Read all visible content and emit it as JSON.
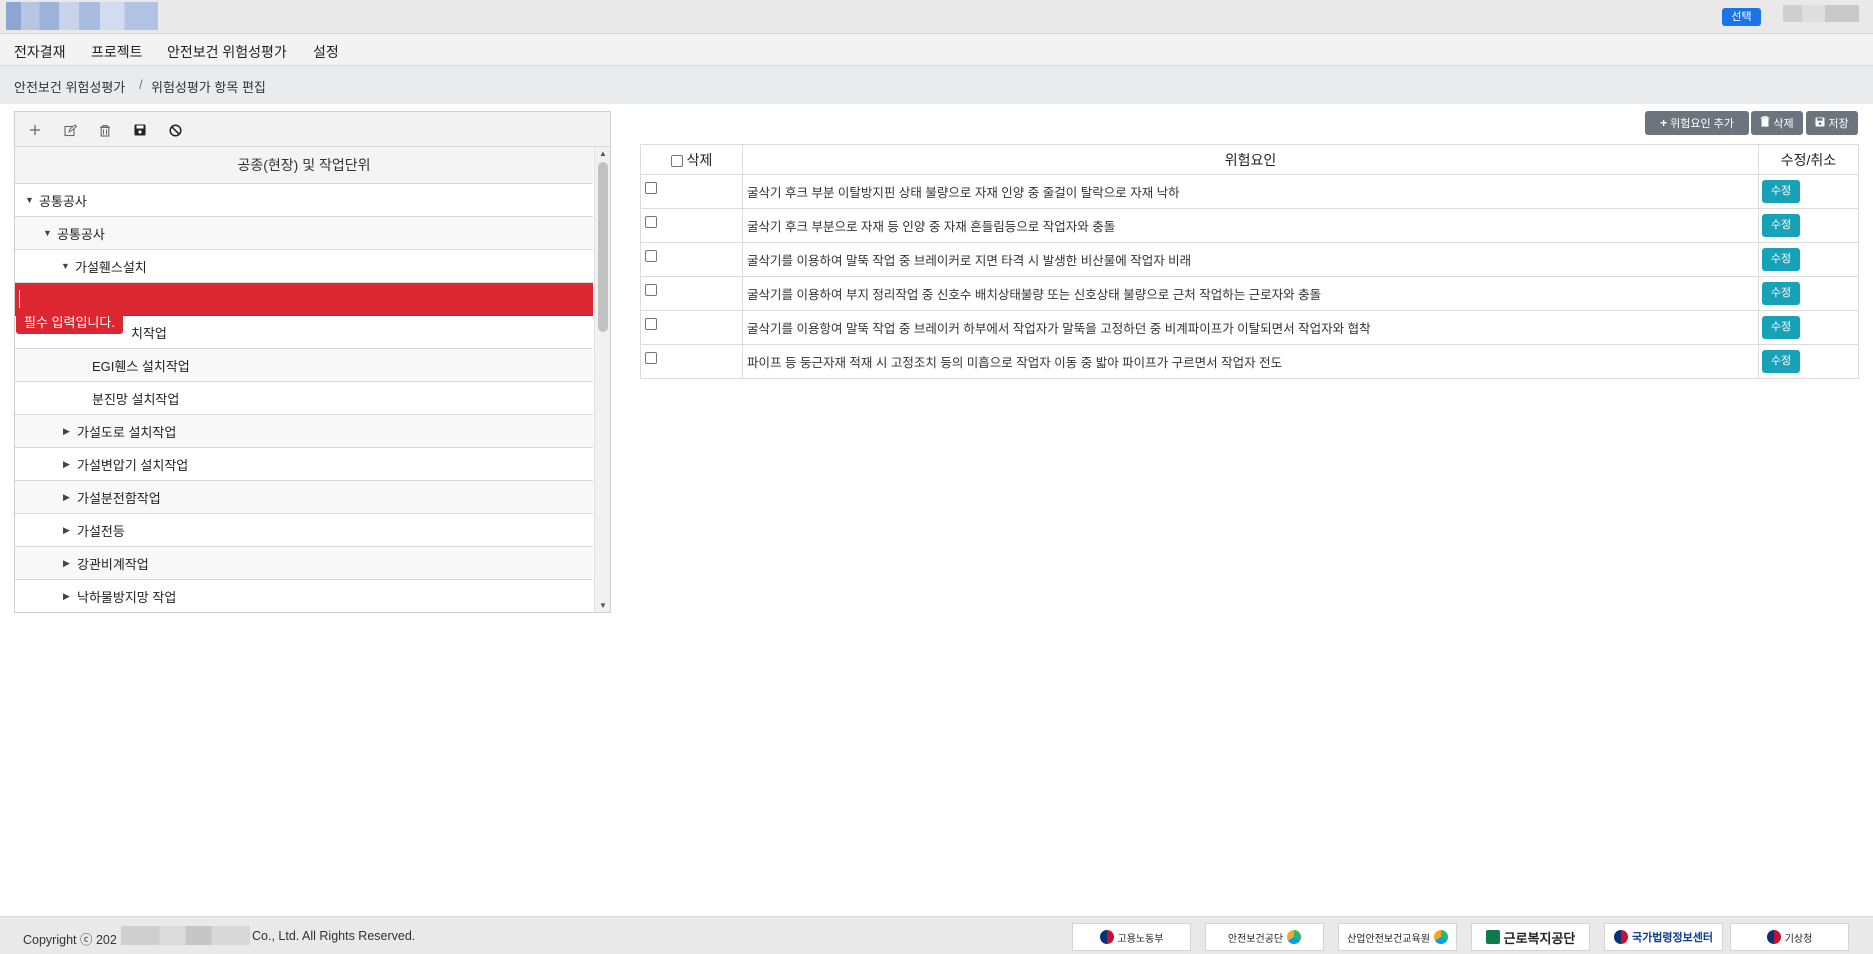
{
  "topbar": {
    "select_label": "선택"
  },
  "menu": [
    "전자결재",
    "프로젝트",
    "안전보건 위험성평가",
    "설정"
  ],
  "breadcrumb": {
    "parent": "안전보건 위험성평가",
    "separator": "/",
    "current": "위험성평가 항목 편집"
  },
  "tree": {
    "header": "공종(현장) 및 작업단위",
    "error_message": "필수 입력입니다.",
    "edit_value": "",
    "rows": [
      {
        "label": "공통공사",
        "level": 0,
        "state": "expanded"
      },
      {
        "label": "공통공사",
        "level": 1,
        "state": "expanded"
      },
      {
        "label": "가설휀스설치",
        "level": 2,
        "state": "expanded"
      },
      {
        "label": "",
        "level": 3,
        "state": "editing"
      },
      {
        "label": "치작업",
        "level": 3,
        "state": "leaf"
      },
      {
        "label": "EGI휀스 설치작업",
        "level": 3,
        "state": "leaf"
      },
      {
        "label": "분진망 설치작업",
        "level": 3,
        "state": "leaf"
      },
      {
        "label": "가설도로 설치작업",
        "level": 2,
        "state": "collapsed"
      },
      {
        "label": "가설변압기 설치작업",
        "level": 2,
        "state": "collapsed"
      },
      {
        "label": "가설분전함작업",
        "level": 2,
        "state": "collapsed"
      },
      {
        "label": "가설전등",
        "level": 2,
        "state": "collapsed"
      },
      {
        "label": "강관비계작업",
        "level": 2,
        "state": "collapsed"
      },
      {
        "label": "낙하물방지망 작업",
        "level": 2,
        "state": "collapsed"
      }
    ]
  },
  "actions": {
    "add_label": "위험요인 추가",
    "delete_label": "삭제",
    "save_label": "저장"
  },
  "table": {
    "headers": {
      "delete": "삭제",
      "risk": "위험요인",
      "edit": "수정/취소"
    },
    "edit_button_label": "수정",
    "rows": [
      "굴삭기 후크 부분 이탈방지핀 상태 불량으로 자재 인양 중 줄걸이 탈락으로 자재 낙하",
      "굴삭기 후크 부분으로 자재 등 인양 중 자재 흔들림등으로 작업자와 충돌",
      "굴삭기를 이용하여 말뚝 작업 중 브레이커로 지면 타격 시 발생한 비산물에 작업자 비래",
      "굴삭기를 이용하여 부지 정리작업 중 신호수 배치상태불량 또는 신호상태 불량으로 근처 작업하는 근로자와 충돌",
      "굴삭기를 이용항여 말뚝 작업 중 브레이커 하부에서 작업자가 말뚝을 고정하던 중 비계파이프가 이탈되면서 작업자와 협착",
      "파이프 등 둥근자재 적재 시 고정조치 등의 미흡으로 작업자 이동 중 밟아 파이프가 구르면서 작업자 전도"
    ]
  },
  "footer": {
    "copyright_prefix": "Copyright ⓒ 202",
    "copyright_suffix": "Co., Ltd. All Rights Reserved.",
    "logos": [
      "고용노동부",
      "안전보건공단",
      "산업안전보건교육원",
      "근로복지공단",
      "국가법령정보센터",
      "기상청"
    ]
  },
  "colors": {
    "error": "#dc2632",
    "primary": "#1a73e8",
    "edit": "#17a2b8",
    "action": "#6c757d"
  }
}
